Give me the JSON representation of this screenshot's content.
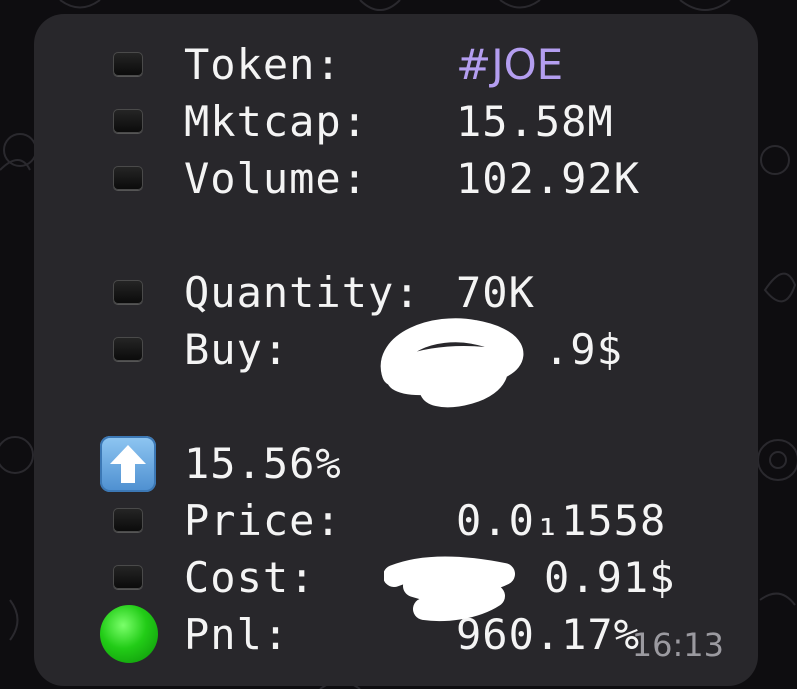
{
  "message": {
    "token_label": "Token:",
    "token_value": "#JOE",
    "mktcap_label": "Mktcap:",
    "mktcap_value": "15.58M",
    "volume_label": "Volume:",
    "volume_value": "102.92K",
    "quantity_label": "Quantity:",
    "quantity_value": "70K",
    "buy_label": "Buy:",
    "buy_value_visible": ".9$",
    "change_value": "15.56%",
    "price_label": "Price:",
    "price_value": "0.0₁1558",
    "cost_label": "Cost:",
    "cost_value_visible": "0.91$",
    "pnl_label": "Pnl:",
    "pnl_value": "960.17%",
    "time": "16:13"
  },
  "icons": {
    "bullet": "black-square-button-icon",
    "change": "up-arrow-emoji-icon",
    "pnl": "green-circle-emoji-icon"
  },
  "colors": {
    "bubble": "#28272b",
    "background": "#0e0d10",
    "text": "#f4f4f4",
    "hashtag": "#b49ef0",
    "timestamp": "#9b9aa0"
  }
}
